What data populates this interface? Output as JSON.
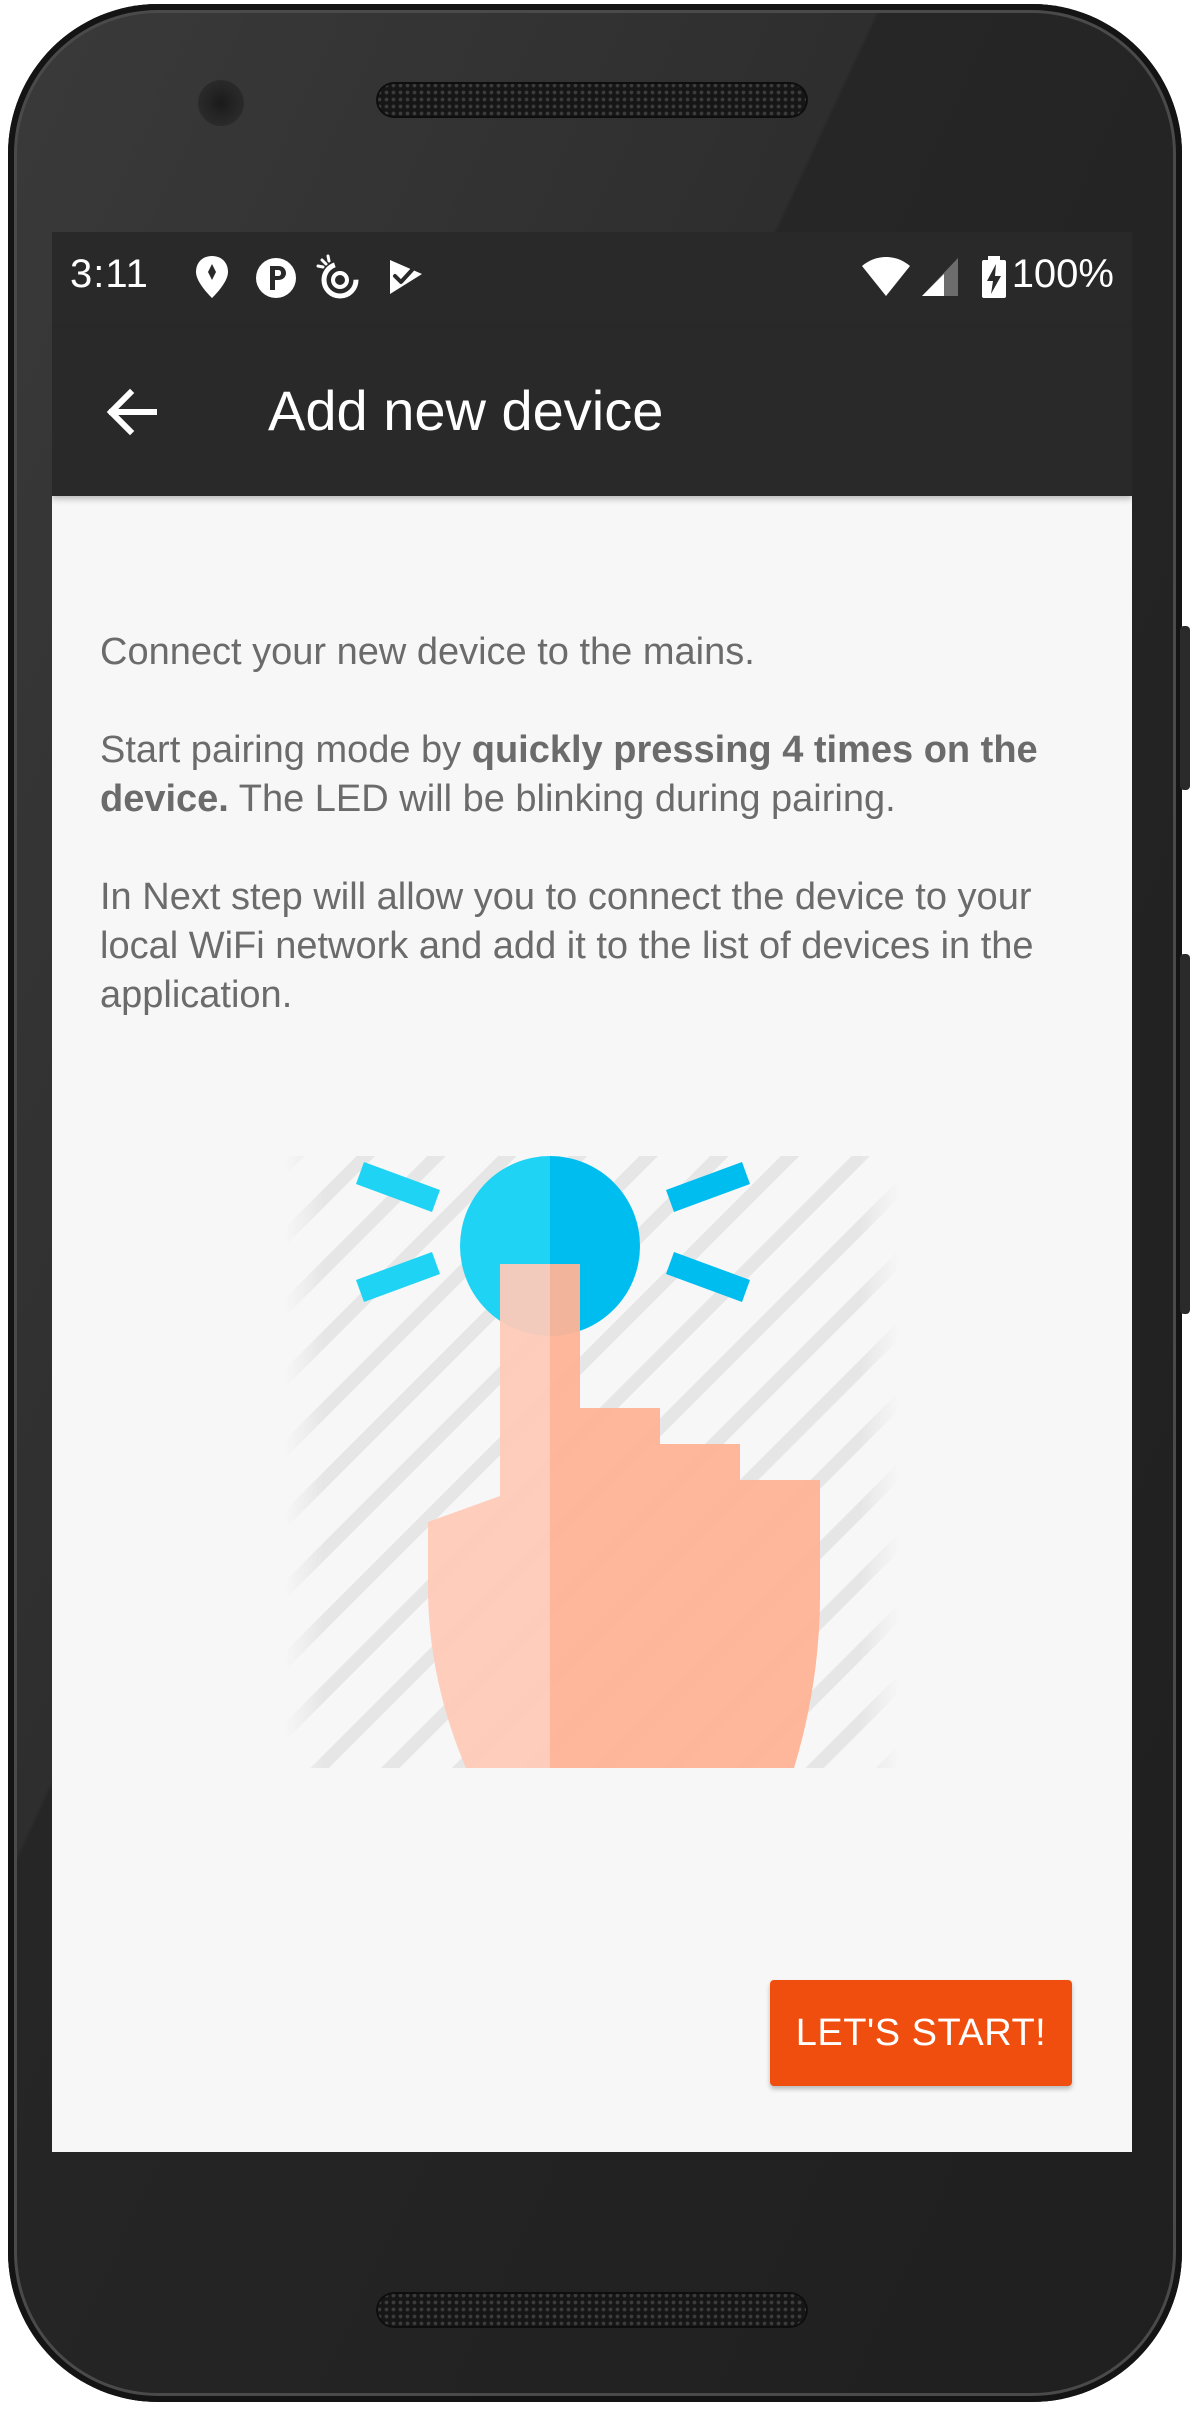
{
  "status_bar": {
    "time": "3:11",
    "battery_percent": "100%",
    "icons": [
      "location-pin-icon",
      "parking-p-icon",
      "sync-swirl-icon",
      "check-flag-icon",
      "wifi-icon",
      "cell-signal-icon",
      "battery-charging-icon"
    ]
  },
  "app_bar": {
    "title": "Add new device",
    "back_icon": "arrow-back-icon"
  },
  "instructions": {
    "p1": "Connect your new device to the mains.",
    "p2_prefix": "Start pairing mode by ",
    "p2_bold": "quickly pressing 4 times on the device.",
    "p2_suffix": " The LED will be blinking during pairing.",
    "p3": "In Next step will allow you to connect the device to your local WiFi network and add it to the list of devices in the application."
  },
  "illustration": {
    "icon": "finger-pressing-button-icon",
    "colors": {
      "button": "#1fd3f5",
      "button_shade": "#00bdf0",
      "hand": "#ffcab8",
      "hand_shade": "#ffb396"
    }
  },
  "actions": {
    "start_label": "LET'S START!"
  },
  "colors": {
    "bar": "#292929",
    "accent": "#f04e0e",
    "screen_bg": "#f7f7f7",
    "text": "#6b6b6b"
  }
}
